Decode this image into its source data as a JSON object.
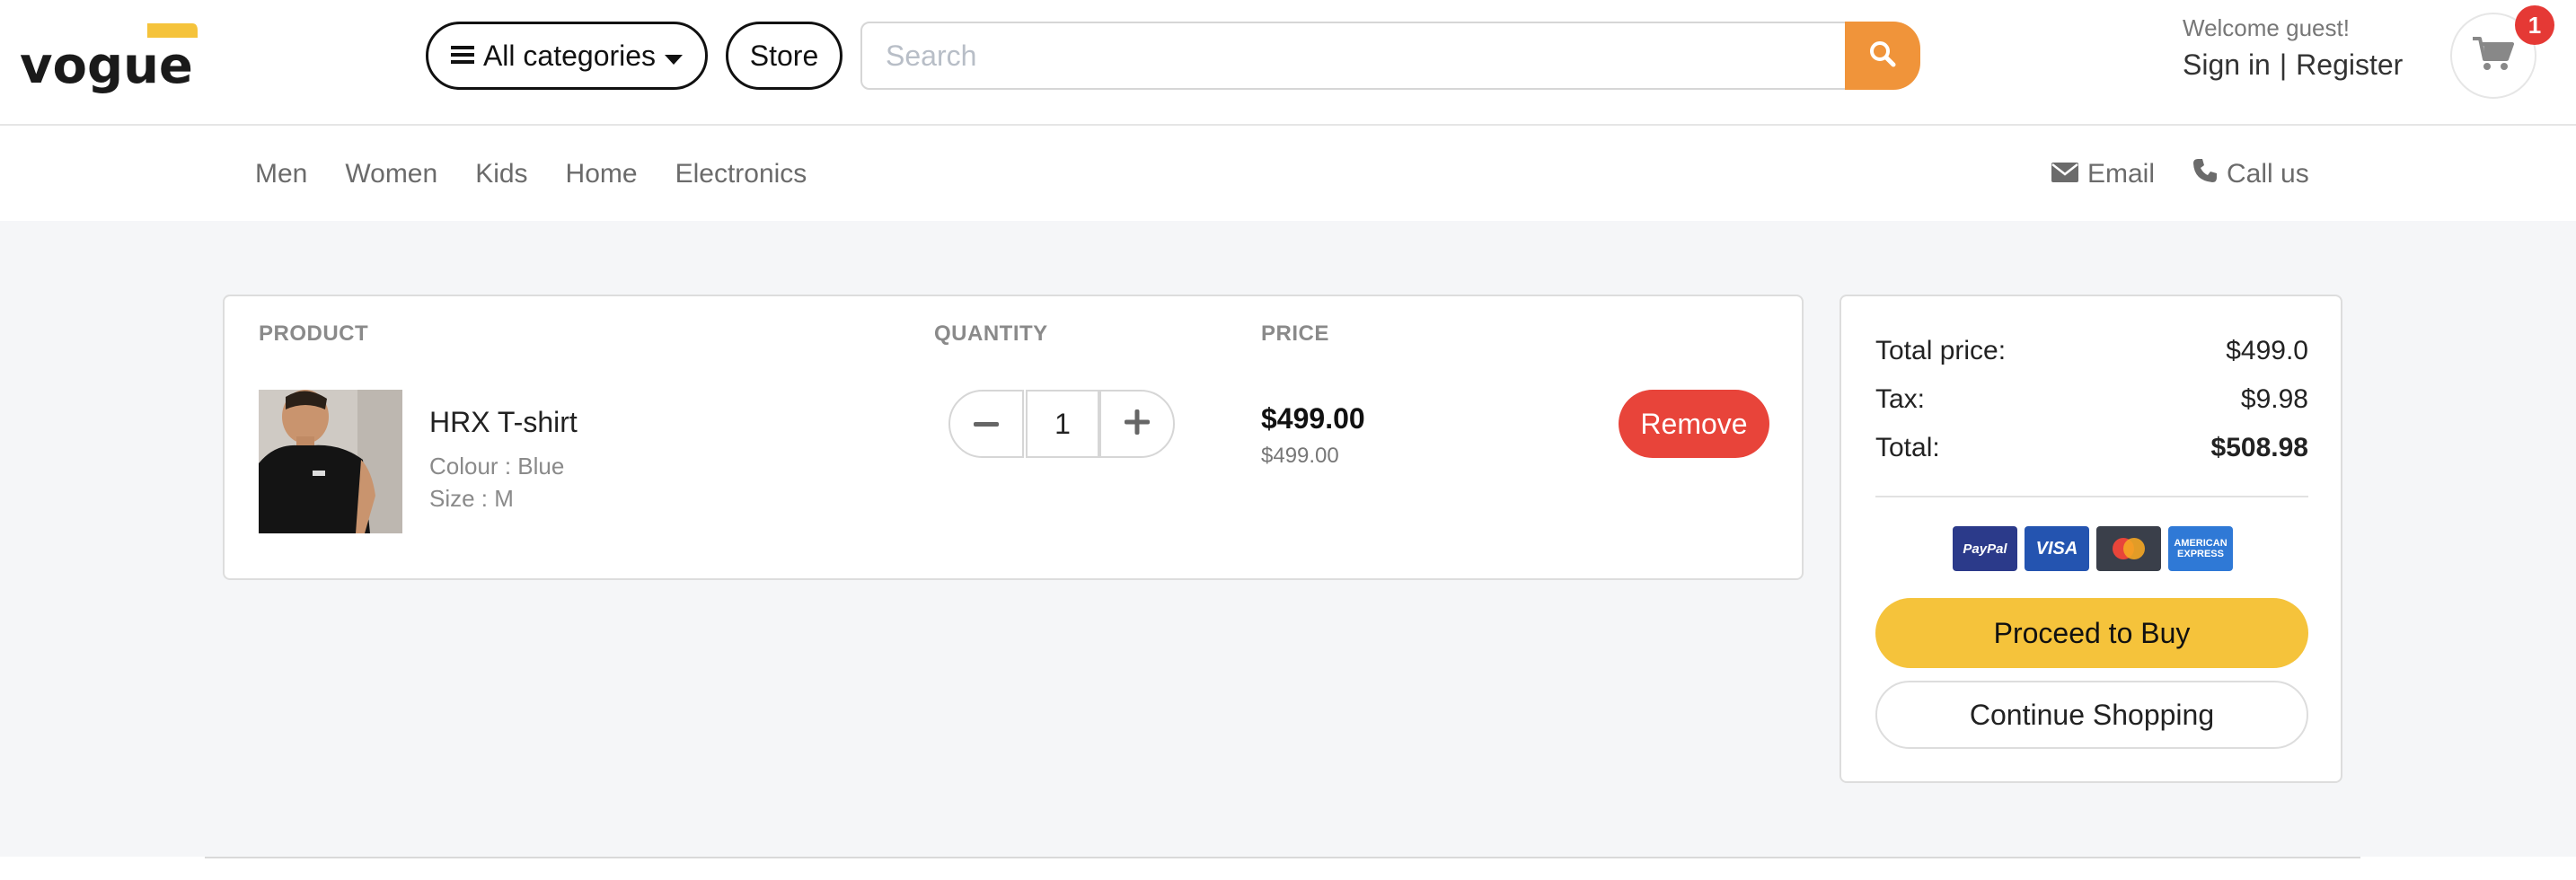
{
  "brand": {
    "logo_text": "vogue",
    "accent_color": "#f5c33b"
  },
  "header": {
    "categories_label": "All categories",
    "store_label": "Store",
    "search_placeholder": "Search",
    "search_color": "#f0943a",
    "welcome": "Welcome guest!",
    "sign_in": "Sign in",
    "separator": "|",
    "register": "Register",
    "cart_count": "1"
  },
  "nav": {
    "items": [
      "Men",
      "Women",
      "Kids",
      "Home",
      "Electronics"
    ],
    "email": "Email",
    "call": "Call us"
  },
  "cart": {
    "headers": {
      "product": "PRODUCT",
      "quantity": "QUANTITY",
      "price": "PRICE"
    },
    "items": [
      {
        "name": "HRX T-shirt",
        "colour": "Colour : Blue",
        "size": "Size : M",
        "quantity": "1",
        "price": "$499.00",
        "unit_price": "$499.00",
        "remove_label": "Remove"
      }
    ]
  },
  "summary": {
    "total_price_label": "Total price:",
    "total_price_value": "$499.0",
    "tax_label": "Tax:",
    "tax_value": "$9.98",
    "total_label": "Total:",
    "total_value": "$508.98",
    "payment_icons": [
      "paypal-icon",
      "visa-icon",
      "mastercard-icon",
      "amex-icon"
    ],
    "paypal_text": "PayPal",
    "visa_text": "VISA",
    "amex_text_1": "AMERICAN",
    "amex_text_2": "EXPRESS",
    "buy_label": "Proceed to Buy",
    "continue_label": "Continue Shopping"
  },
  "colors": {
    "remove": "#e8443a",
    "buy": "#f5c33b",
    "badge": "#e53935"
  }
}
